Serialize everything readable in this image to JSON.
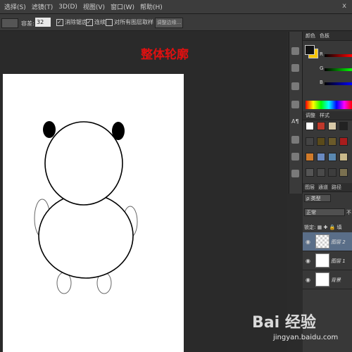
{
  "menubar": {
    "items": [
      "选择(S)",
      "滤镜(T)",
      "3D(D)",
      "视图(V)",
      "窗口(W)",
      "帮助(H)"
    ],
    "close": "x"
  },
  "options": {
    "tolerance_label": "容差:",
    "tolerance_value": "32",
    "antialias": "消除锯齿",
    "contiguous": "连续",
    "sample_all": "对所有图层取样",
    "refine_edge": "调整边缘..."
  },
  "canvas": {
    "title": "整体轮廓"
  },
  "iconstrip": {
    "text_tool": "A¶"
  },
  "panels": {
    "color_tabs": [
      "颜色",
      "色板"
    ],
    "channels": [
      "R",
      "G",
      "B"
    ],
    "style_tabs": [
      "调整",
      "样式"
    ],
    "layer_tabs": [
      "图层",
      "通道",
      "路径"
    ],
    "kind_filter": "ρ 类型",
    "blend_mode": "正常",
    "opacity_short": "不",
    "lock_label": "锁定:",
    "fill_short": "填",
    "colors": {
      "foreground": "#111111",
      "background": "#f5c400",
      "active_layer": "#5a6e88"
    }
  },
  "layers": [
    {
      "name": "图层 2",
      "active": true,
      "thumb": "transparent"
    },
    {
      "name": "图层 1",
      "active": false,
      "thumb": "white"
    },
    {
      "name": "背景",
      "active": false,
      "thumb": "white"
    }
  ],
  "watermark": {
    "logo": "Bai 经验",
    "url": "jingyan.baidu.com"
  }
}
